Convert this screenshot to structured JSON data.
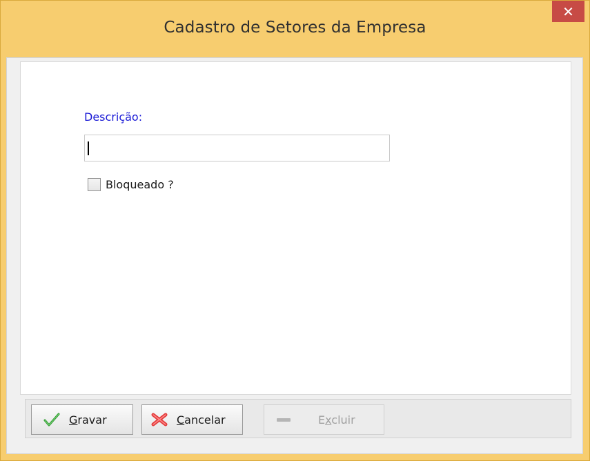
{
  "window": {
    "title": "Cadastro de Setores da Empresa",
    "close_glyph": "✕"
  },
  "form": {
    "descricao_label": "Descrição:",
    "descricao_value": "",
    "bloqueado_label": "Bloqueado ?",
    "bloqueado_checked": false
  },
  "toolbar": {
    "gravar": {
      "mnemonic": "G",
      "rest": "ravar",
      "icon": "check-icon"
    },
    "cancelar": {
      "mnemonic": "C",
      "rest": "ancelar",
      "icon": "x-icon"
    },
    "excluir": {
      "pre": "E",
      "mnemonic": "x",
      "rest": "cluir",
      "icon": "minus-icon",
      "enabled": false
    }
  },
  "colors": {
    "frame": "#f7cd6f",
    "close_button": "#c74b45",
    "label_blue": "#1a1ad6"
  }
}
